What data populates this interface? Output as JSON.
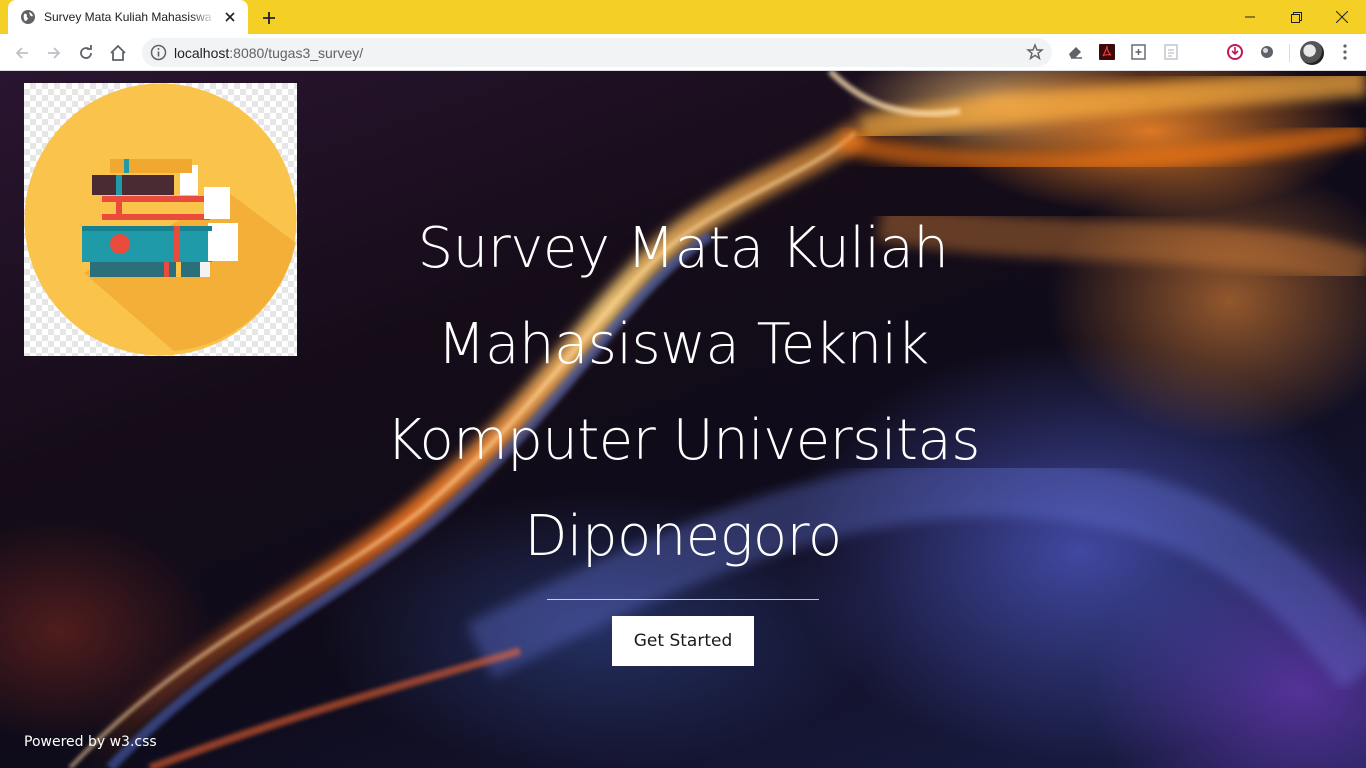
{
  "browser": {
    "tab": {
      "title": "Survey Mata Kuliah Mahasiswa Teknik Komputer Universitas Diponegoro",
      "favicon": "globe-icon"
    },
    "address": {
      "host": "localhost",
      "path": ":8080/tugas3_survey/"
    },
    "colors": {
      "tabstrip": "#f4cf25",
      "toolbar": "#ffffff",
      "omnibox": "#f1f3f4"
    }
  },
  "page": {
    "logo_alt": "books-logo",
    "title_lines": [
      "Survey Mata Kuliah",
      "Mahasiswa Teknik",
      "Komputer Universitas",
      "Diponegoro"
    ],
    "cta_label": "Get Started",
    "footer_text": "Powered by w3.css"
  }
}
